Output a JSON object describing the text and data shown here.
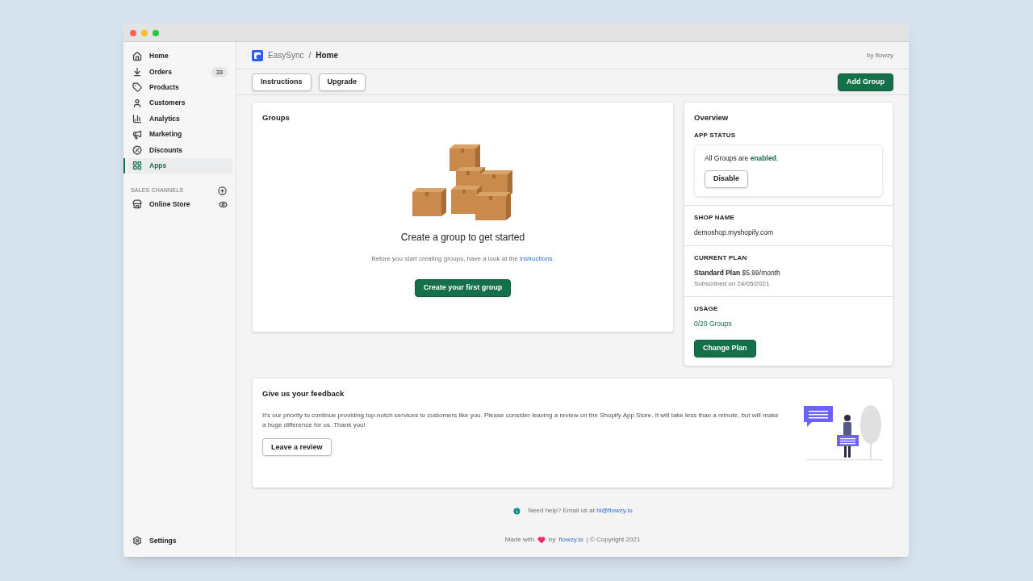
{
  "sidebar": {
    "items": [
      {
        "label": "Home",
        "selected": false
      },
      {
        "label": "Orders",
        "selected": false,
        "badge": "33"
      },
      {
        "label": "Products",
        "selected": false
      },
      {
        "label": "Customers",
        "selected": false
      },
      {
        "label": "Analytics",
        "selected": false
      },
      {
        "label": "Marketing",
        "selected": false
      },
      {
        "label": "Discounts",
        "selected": false
      },
      {
        "label": "Apps",
        "selected": true
      }
    ],
    "section": {
      "title": "SALES CHANNELS",
      "items": [
        {
          "label": "Online Store",
          "selected": false
        }
      ]
    },
    "settings": "Settings"
  },
  "header": {
    "app": "EasySync",
    "separator": "/",
    "page": "Home",
    "by": "by flowzy"
  },
  "toolbar": {
    "buttons": [
      "Instructions",
      "Upgrade"
    ],
    "primary": "Add Group"
  },
  "groups": {
    "title": "Groups",
    "heading": "Create a group to get started",
    "text": "Before you start creating groups, have a look at the",
    "link": "instructions",
    "after": ".",
    "button": "Create your first group"
  },
  "overview": {
    "title": "Overview",
    "app_status": {
      "label": "APP STATUS",
      "text": "All Groups are **enabled**.",
      "button": "Disable"
    },
    "shop": {
      "label": "SHOP NAME",
      "value": "demoshop.myshopify.com"
    },
    "plan": {
      "label": "CURRENT PLAN",
      "value": "**Standard Plan** $5.99/month",
      "sub": "Subscribed on 24/05/2021"
    },
    "usage": {
      "label": "USAGE",
      "value": "0/20 Groups",
      "button": "Change Plan"
    }
  },
  "feedback": {
    "title": "Give us your feedback",
    "text": "It's our priority to continue providing top-notch services to customers like you. Please consider leaving a review on the Shopify App Store. It will take less than a minute, but will make a huge difference for us. Thank you!",
    "button": "Leave a review"
  },
  "help": {
    "text": "Need help? Email us at",
    "link": "hi@flowzy.io"
  },
  "footer": {
    "before": "Made with",
    "by": "by",
    "link": "flowzy.io",
    "after": "| © Copyright 2021"
  }
}
